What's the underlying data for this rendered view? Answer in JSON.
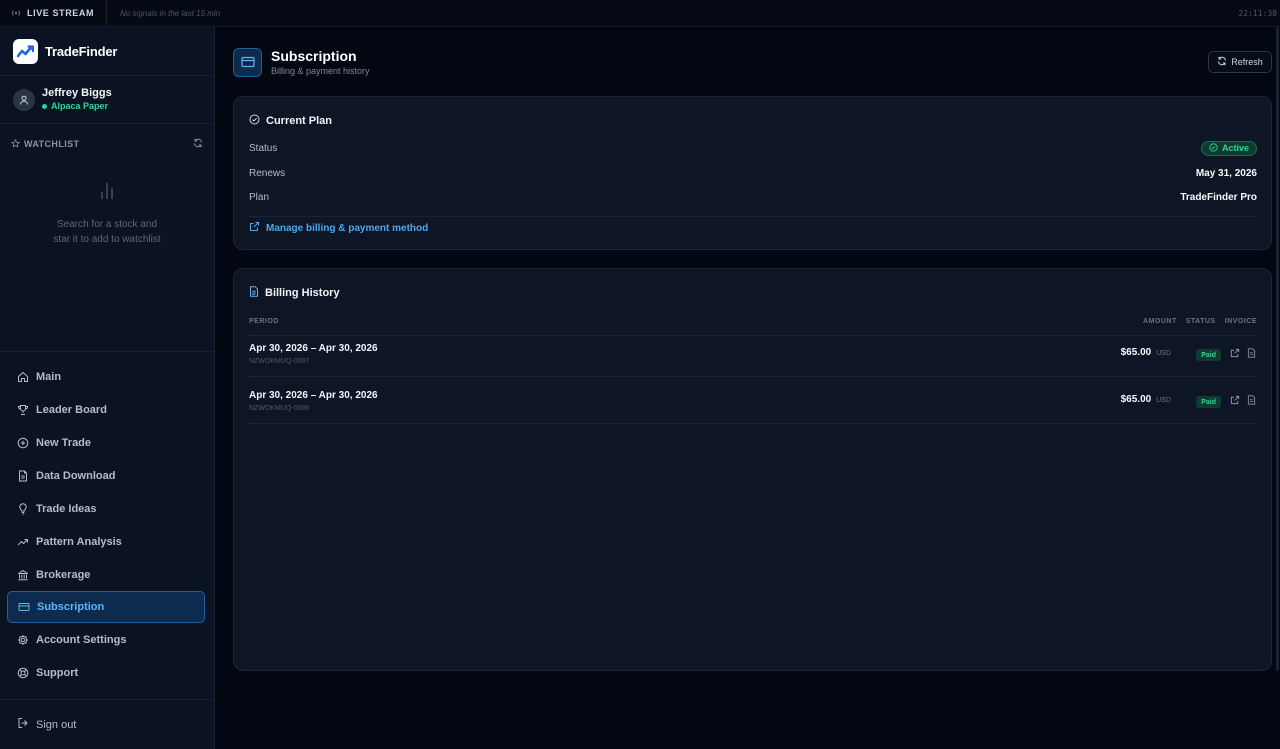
{
  "ticker": {
    "label": "LIVE STREAM",
    "message": "No signals in the last 15 min",
    "clock": "22:11:38"
  },
  "brand": {
    "name": "TradeFinder"
  },
  "user": {
    "name": "Jeffrey Biggs",
    "account": "Alpaca Paper"
  },
  "watchlist": {
    "title": "WATCHLIST",
    "empty_line1": "Search for a stock and",
    "empty_line2": "star it to add to watchlist"
  },
  "nav": {
    "items": [
      {
        "label": "Main",
        "icon": "home-icon"
      },
      {
        "label": "Leader Board",
        "icon": "trophy-icon"
      },
      {
        "label": "New Trade",
        "icon": "plus-circle-icon"
      },
      {
        "label": "Data Download",
        "icon": "file-icon"
      },
      {
        "label": "Trade Ideas",
        "icon": "lightbulb-icon"
      },
      {
        "label": "Pattern Analysis",
        "icon": "trend-icon"
      },
      {
        "label": "Brokerage",
        "icon": "bank-icon"
      },
      {
        "label": "Subscription",
        "icon": "credit-card-icon",
        "active": true
      },
      {
        "label": "Account Settings",
        "icon": "gear-icon"
      },
      {
        "label": "Support",
        "icon": "lifebuoy-icon"
      }
    ],
    "signout": "Sign out"
  },
  "page": {
    "title": "Subscription",
    "subtitle": "Billing & payment history",
    "refresh_label": "Refresh"
  },
  "plan": {
    "title": "Current Plan",
    "status_label": "Status",
    "status_value": "Active",
    "renews_label": "Renews",
    "renews_value": "May 31, 2026",
    "plan_label": "Plan",
    "plan_value": "TradeFinder Pro",
    "manage_label": "Manage billing & payment method"
  },
  "billing": {
    "title": "Billing History",
    "columns": {
      "period": "PERIOD",
      "amount": "AMOUNT",
      "status": "STATUS",
      "invoice": "INVOICE"
    },
    "rows": [
      {
        "period": "Apr 30, 2026 – Apr 30, 2026",
        "id": "NZWOKMUQ-0007",
        "amount": "$65.00",
        "currency": "USD",
        "status": "Paid"
      },
      {
        "period": "Apr 30, 2026 – Apr 30, 2026",
        "id": "NZWOKMUQ-0006",
        "amount": "$65.00",
        "currency": "USD",
        "status": "Paid"
      }
    ]
  },
  "colors": {
    "accent": "#4ba8ef",
    "success": "#34d399",
    "background": "#030711",
    "card": "#0e1626"
  }
}
